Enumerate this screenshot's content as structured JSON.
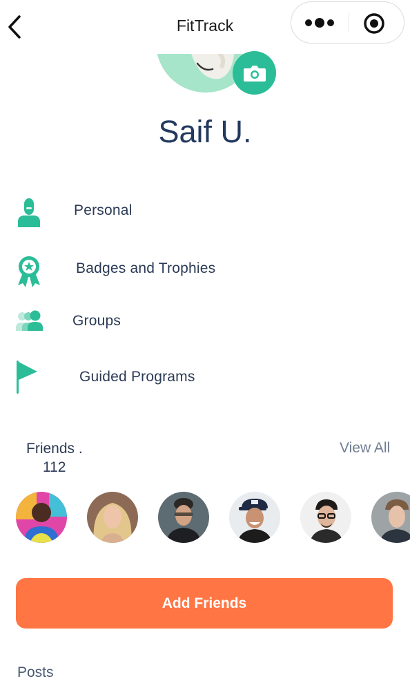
{
  "header": {
    "title": "FitTrack",
    "back_icon": "chevron-left-icon",
    "more_icon": "more-dots-icon",
    "target_icon": "target-icon"
  },
  "profile": {
    "name": "Saif U.",
    "camera_icon": "camera-icon"
  },
  "menu": {
    "items": [
      {
        "label": "Personal",
        "icon": "person-icon"
      },
      {
        "label": "Badges and Trophies",
        "icon": "badge-icon"
      },
      {
        "label": "Groups",
        "icon": "groups-icon"
      },
      {
        "label": "Guided Programs",
        "icon": "flag-icon"
      }
    ]
  },
  "friends": {
    "title": "Friends .",
    "count": "112",
    "view_all": "View All"
  },
  "actions": {
    "add_friends": "Add Friends"
  },
  "posts": {
    "label": "Posts"
  },
  "colors": {
    "accent": "#2bbd97",
    "primary_button": "#ff7543",
    "name_text": "#233a5e"
  }
}
